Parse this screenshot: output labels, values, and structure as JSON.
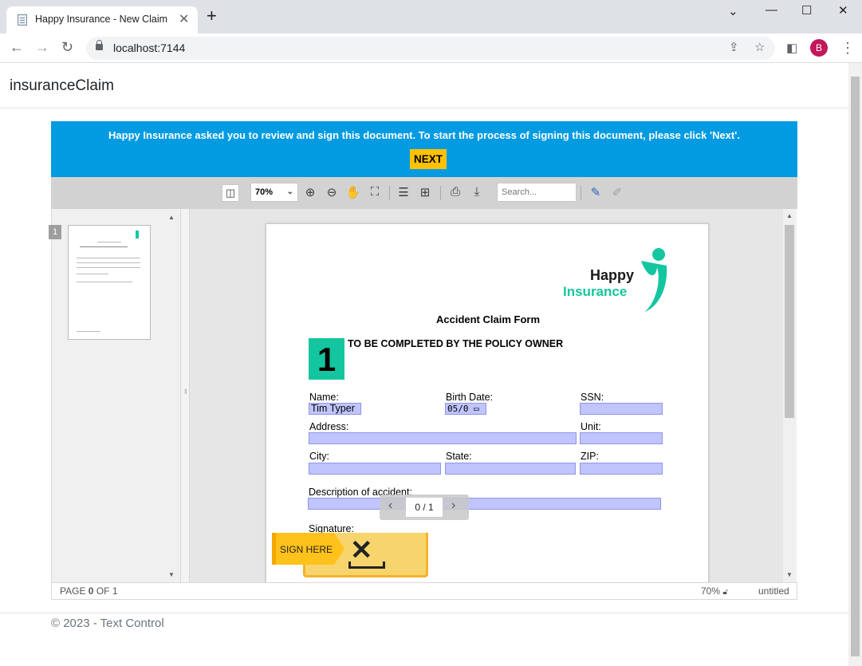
{
  "browser": {
    "tab_title": "Happy Insurance - New Claim",
    "tab_close": "✕",
    "new_tab": "+",
    "url": "localhost:7144",
    "profile_initial": "B",
    "window_controls": {
      "minimize": "—",
      "maximize": "☐",
      "close": "✕"
    },
    "icons": [
      "back-icon",
      "forward-icon",
      "reload-icon",
      "lock-icon",
      "share-icon",
      "star-icon",
      "sidepanel-icon",
      "menu-icon"
    ]
  },
  "page": {
    "brand": "insuranceClaim",
    "footer": "© 2023 - Text Control"
  },
  "viewer": {
    "banner_message": "Happy Insurance asked you to review and sign this document. To start the process of signing this document, please click 'Next'.",
    "next_label": "NEXT",
    "zoom_value": "70%",
    "search_placeholder": "Search...",
    "thumbnail_number": "1",
    "nav_counter": "0 / 1",
    "status": {
      "page_prefix": "PAGE ",
      "page_current": "0",
      "page_suffix": " OF 1",
      "zoom": "70%",
      "doc_name": "untitled"
    }
  },
  "document": {
    "logo_line1": "Happy",
    "logo_line2": "Insurance",
    "form_title": "Accident Claim Form",
    "section_number": "1",
    "section_title": "TO BE COMPLETED BY THE POLICY OWNER",
    "labels": {
      "name": "Name:",
      "birth_date": "Birth Date:",
      "ssn": "SSN:",
      "address": "Address:",
      "unit": "Unit:",
      "city": "City:",
      "state": "State:",
      "zip": "ZIP:",
      "description": "Description of accident:",
      "signature": "Signature:"
    },
    "values": {
      "name": "Tim Typer",
      "birth_date": "05/0",
      "ssn": "",
      "address": "",
      "unit": "",
      "city": "",
      "state": "",
      "zip": "",
      "description": ""
    },
    "sign_here": "SIGN HERE"
  },
  "colors": {
    "banner": "#029be2",
    "accent_yellow": "#ffc200",
    "brand_teal": "#14c6a0",
    "field_fill": "#c0c4ff"
  }
}
